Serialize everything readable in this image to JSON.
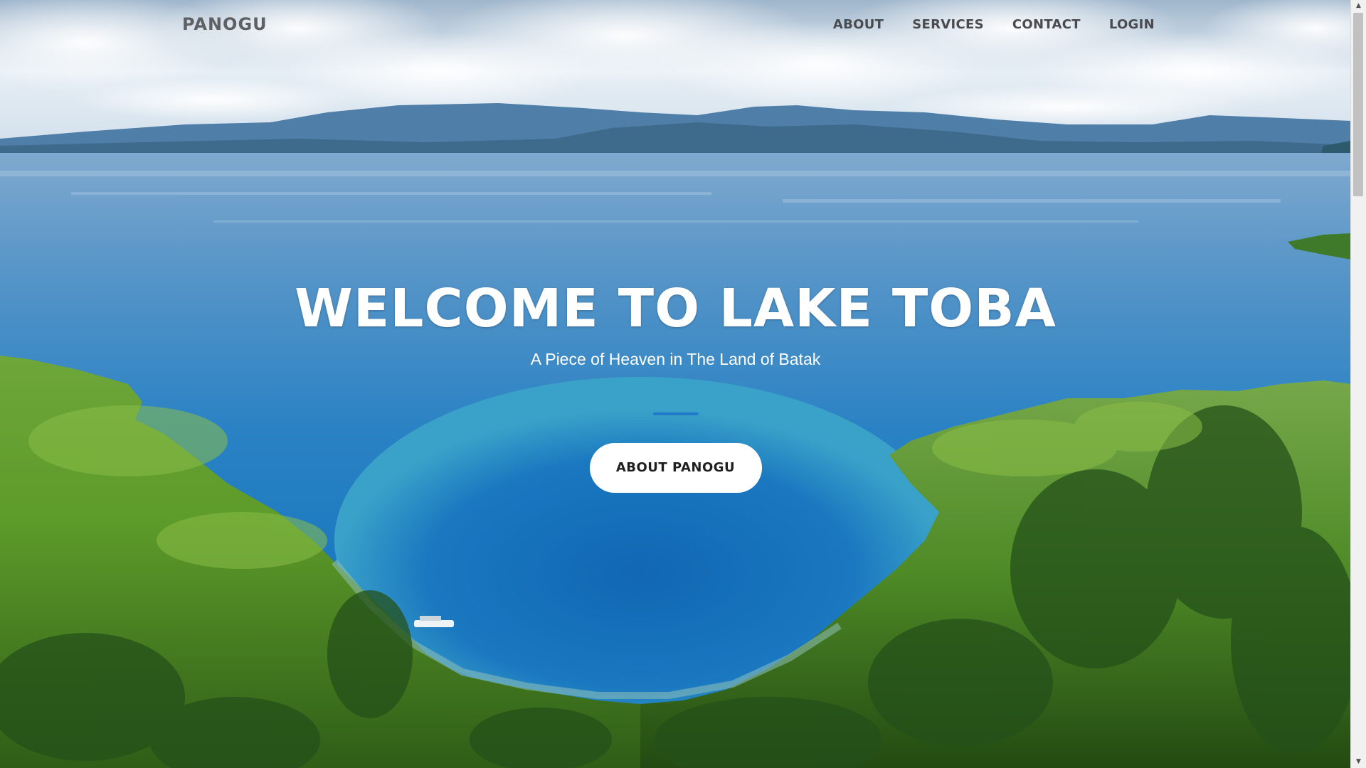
{
  "navbar": {
    "brand": "PANOGU",
    "links": [
      "ABOUT",
      "SERVICES",
      "CONTACT",
      "LOGIN"
    ]
  },
  "hero": {
    "title": "WELCOME TO LAKE TOBA",
    "subtitle": "A Piece of Heaven in The Land of Batak",
    "button_label": "ABOUT PANOGU"
  },
  "colors": {
    "accent": "#1b74c7",
    "nav_text": "#4a4b4e",
    "brand_text": "#5f6063",
    "button_bg": "#ffffff",
    "lake_blue": "#1f86c4",
    "hill_green": "#5a9a2a"
  },
  "scrollbar": {
    "up_icon": "chevron-up-icon",
    "down_icon": "chevron-down-icon"
  }
}
